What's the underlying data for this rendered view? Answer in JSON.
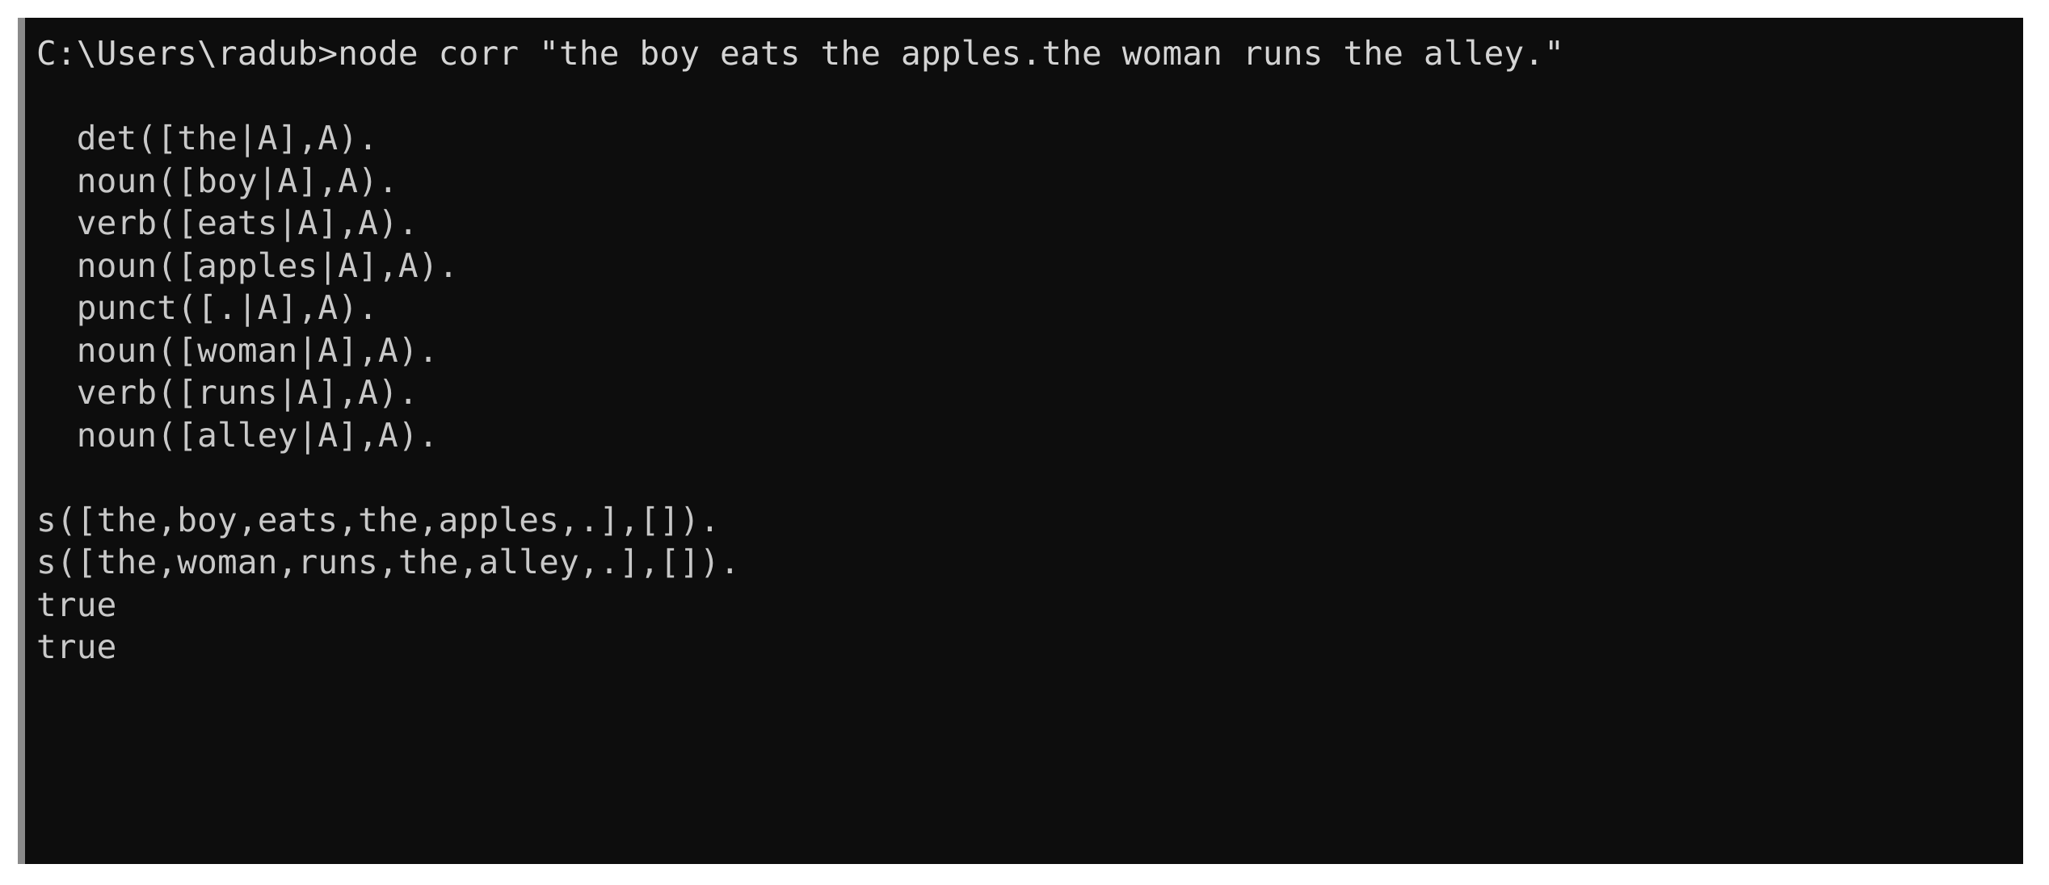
{
  "window": {
    "background_color": "#0d0d0d",
    "text_color": "#c8c8c8",
    "border_color": "#8a8a8a",
    "page_color": "#ffffff"
  },
  "terminal": {
    "prompt": "C:\\Users\\radub>",
    "command": "node corr \"the boy eats the apples.the woman runs the alley.\"",
    "prompt_line": "C:\\Users\\radub>node corr \"the boy eats the apples.the woman runs the alley.\"",
    "lines": [
      {
        "id": "line-prompt",
        "text": "C:\\Users\\radub>node corr \"the boy eats the apples.the woman runs the alley.\""
      },
      {
        "id": "line-blank-1",
        "text": " "
      },
      {
        "id": "line-det-the",
        "text": "  det([the|A],A)."
      },
      {
        "id": "line-noun-boy",
        "text": "  noun([boy|A],A)."
      },
      {
        "id": "line-verb-eats",
        "text": "  verb([eats|A],A)."
      },
      {
        "id": "line-noun-apples",
        "text": "  noun([apples|A],A)."
      },
      {
        "id": "line-punct-dot",
        "text": "  punct([.|A],A)."
      },
      {
        "id": "line-noun-woman",
        "text": "  noun([woman|A],A)."
      },
      {
        "id": "line-verb-runs",
        "text": "  verb([runs|A],A)."
      },
      {
        "id": "line-noun-alley",
        "text": "  noun([alley|A],A)."
      },
      {
        "id": "line-blank-2",
        "text": " "
      },
      {
        "id": "line-s-1",
        "text": "s([the,boy,eats,the,apples,.],[])."
      },
      {
        "id": "line-s-2",
        "text": "s([the,woman,runs,the,alley,.],[])."
      },
      {
        "id": "line-true-1",
        "text": "true"
      },
      {
        "id": "line-true-2",
        "text": "true"
      }
    ]
  }
}
